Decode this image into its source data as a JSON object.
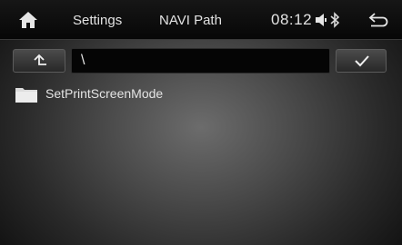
{
  "header": {
    "home_icon": "home-icon",
    "settings_label": "Settings",
    "navi_label": "NAVI Path",
    "time": "08:12",
    "status_icons": [
      "volume-icon",
      "bluetooth-icon"
    ],
    "back_icon": "back-arrow-icon"
  },
  "path_bar": {
    "up_icon": "folder-up-icon",
    "path_value": "\\",
    "confirm_icon": "checkmark-icon"
  },
  "file_list": {
    "items": [
      {
        "icon": "folder-icon",
        "label": "SetPrintScreenMode"
      }
    ]
  }
}
